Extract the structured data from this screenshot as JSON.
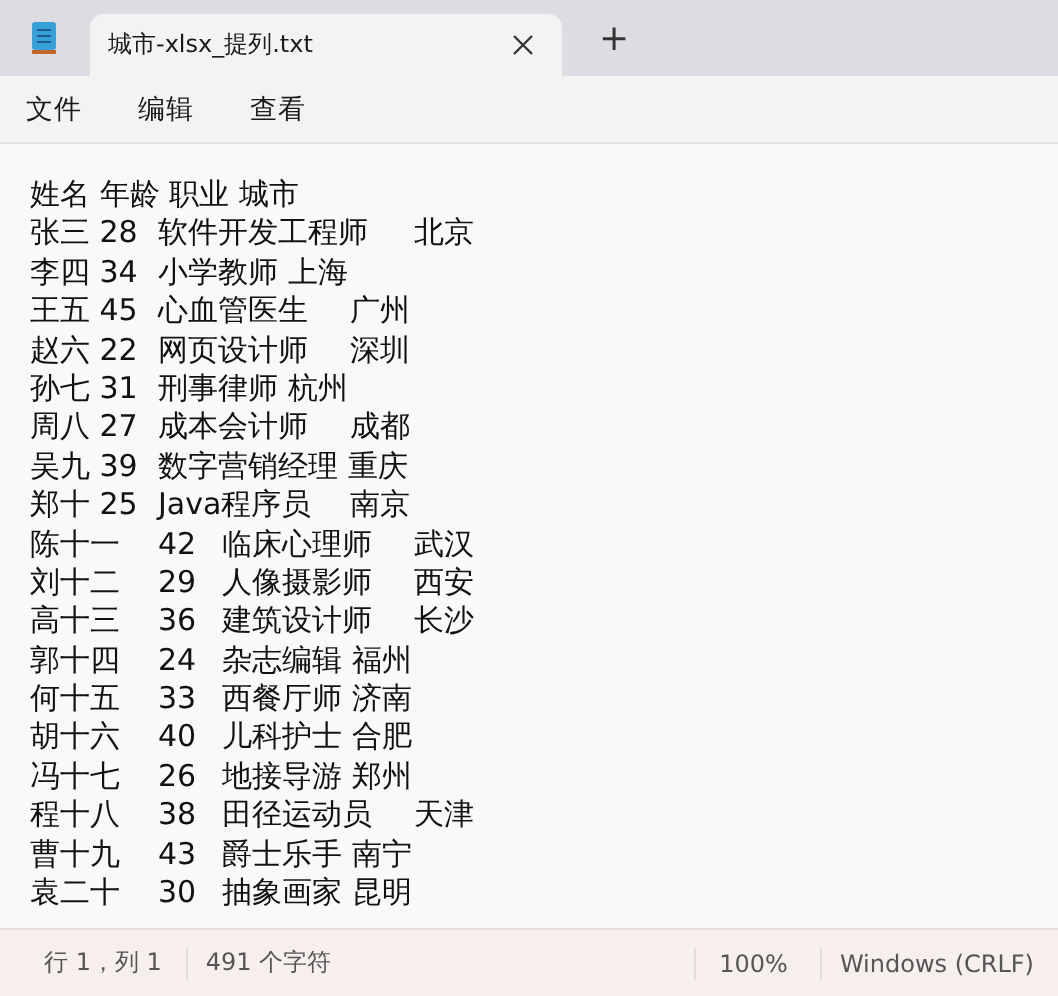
{
  "tabs": [
    {
      "title": "城市-xlsx_提列.txt",
      "selected": true
    }
  ],
  "new_tab": "+",
  "menu": [
    "文件",
    "编辑",
    "查看"
  ],
  "editor": {
    "lines": [
      "姓名 年龄 职业 城市",
      "张三 28\t软件开发工程师\t北京",
      "李四 34\t小学教师 上海",
      "王五 45\t心血管医生\t广州",
      "赵六 22\t网页设计师\t深圳",
      "孙七 31\t刑事律师 杭州",
      "周八 27\t成本会计师\t成都",
      "吴九 39\t数字营销经理 重庆",
      "郑十 25\tJava程序员\t南京",
      "陈十一\t42\t临床心理师\t武汉",
      "刘十二\t29\t人像摄影师\t西安",
      "高十三\t36\t建筑设计师\t长沙",
      "郭十四\t24\t杂志编辑 福州",
      "何十五\t33\t西餐厅师 济南",
      "胡十六\t40\t儿科护士 合肥",
      "冯十七\t26\t地接导游 郑州",
      "程十八\t38\t田径运动员\t天津",
      "曹十九\t43\t爵士乐手 南宁",
      "袁二十\t30\t抽象画家 昆明"
    ]
  },
  "status_bar": {
    "position": "行 1，列 1",
    "characters": "491 个字符",
    "zoom": "100%",
    "line_ending": "Windows (CRLF)"
  }
}
